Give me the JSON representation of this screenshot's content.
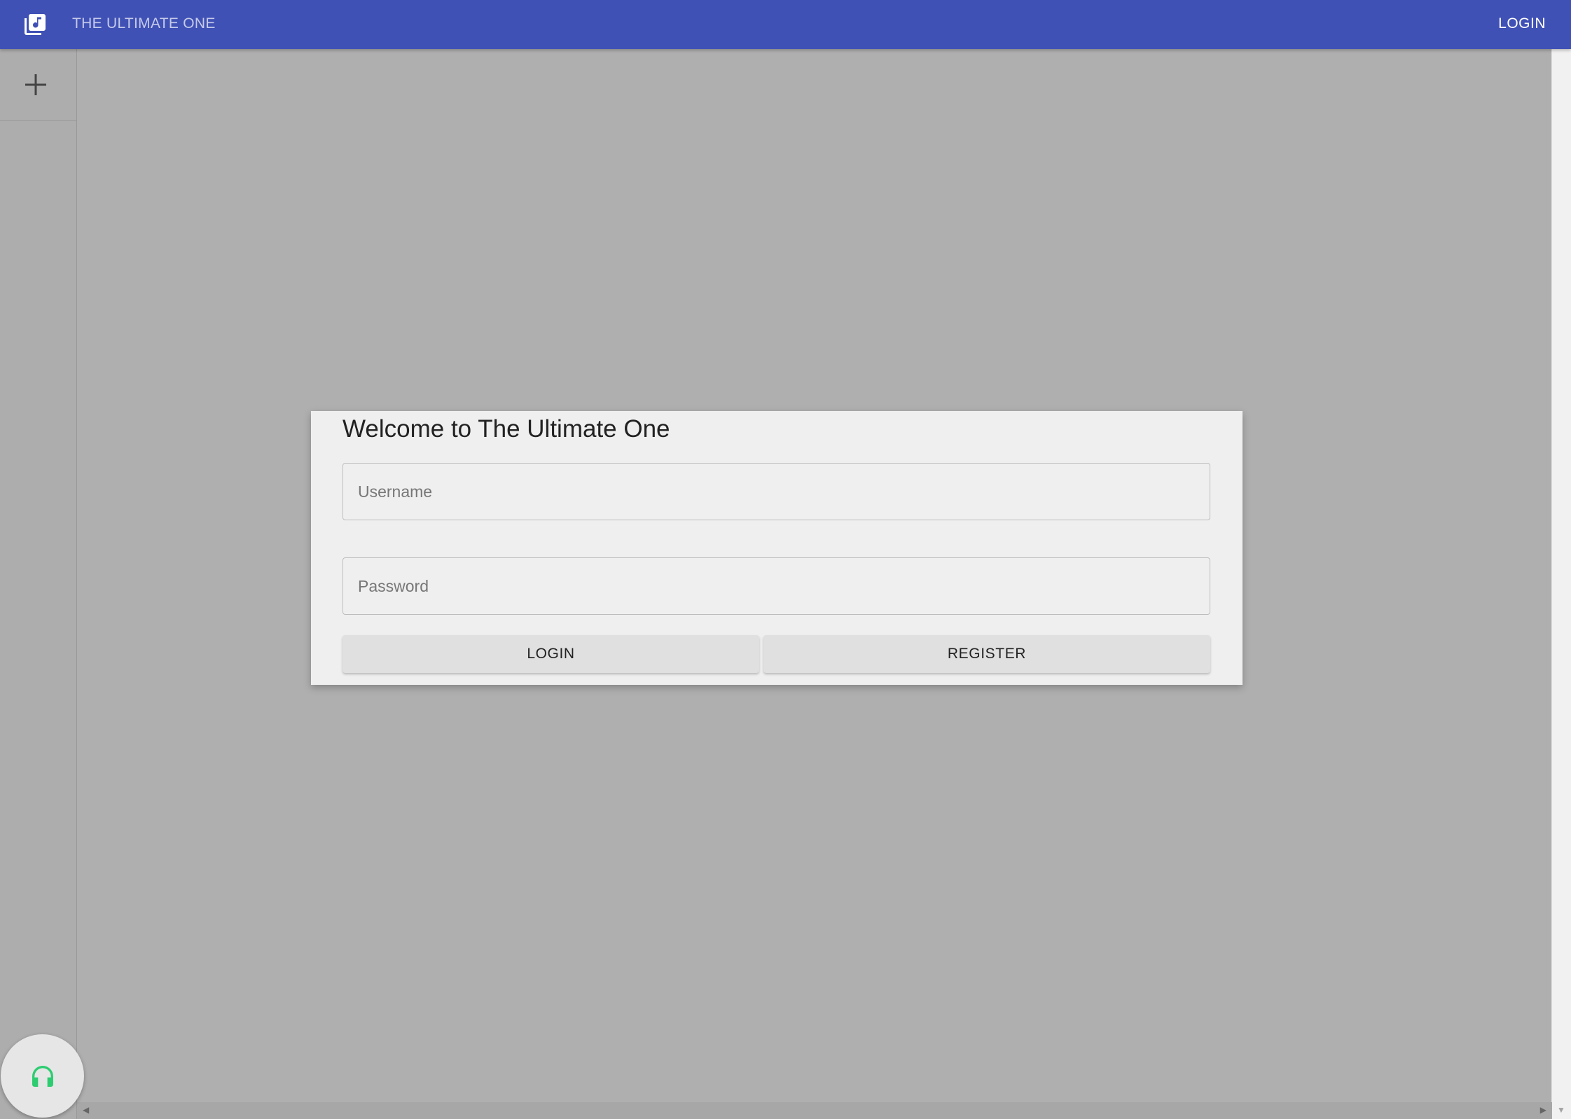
{
  "header": {
    "app_icon": "library-music-icon",
    "title": "THE ULTIMATE ONE",
    "login_label": "LOGIN"
  },
  "sidebar": {
    "add_icon": "plus-icon"
  },
  "dialog": {
    "title": "Welcome to The Ultimate One",
    "username_placeholder": "Username",
    "username_value": "",
    "password_placeholder": "Password",
    "password_value": "",
    "login_label": "LOGIN",
    "register_label": "REGISTER"
  },
  "fab": {
    "icon": "headphones-icon",
    "icon_color": "#2ecc71"
  },
  "colors": {
    "primary": "#3f51b5",
    "overlay": "#afafaf",
    "dialog_bg": "#efefef"
  }
}
